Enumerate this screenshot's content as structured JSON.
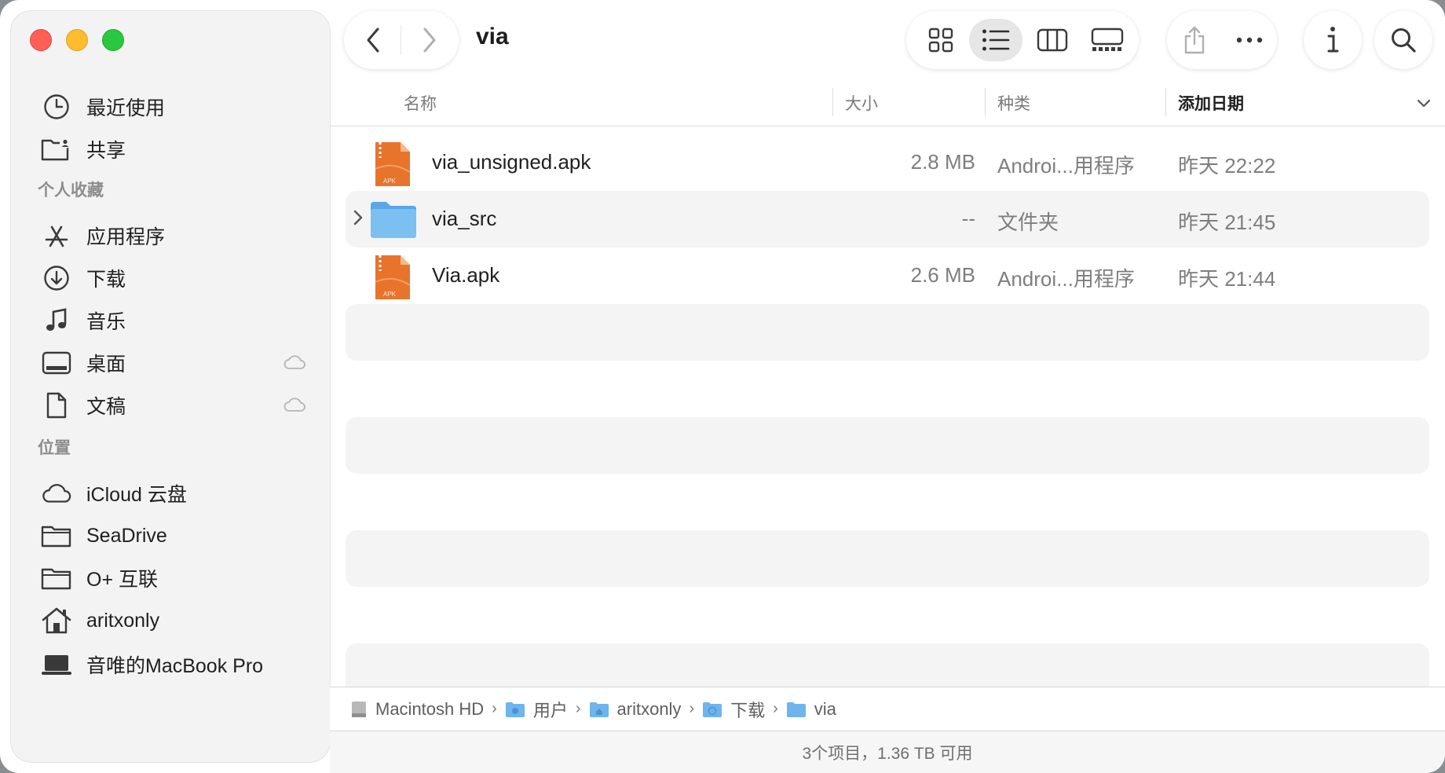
{
  "window": {
    "title": "via"
  },
  "sidebar": {
    "traffic_lights": [
      "close",
      "minimize",
      "zoom"
    ],
    "top_items": [
      {
        "label": "最近使用",
        "icon": "clock-icon"
      },
      {
        "label": "共享",
        "icon": "shared-folder-icon"
      }
    ],
    "favorites_header": "个人收藏",
    "favorites": [
      {
        "label": "应用程序",
        "icon": "applications-icon"
      },
      {
        "label": "下载",
        "icon": "download-icon"
      },
      {
        "label": "音乐",
        "icon": "music-note-icon"
      },
      {
        "label": "桌面",
        "icon": "desktop-icon",
        "cloud": true
      },
      {
        "label": "文稿",
        "icon": "document-icon",
        "cloud": true
      }
    ],
    "locations_header": "位置",
    "locations": [
      {
        "label": "iCloud 云盘",
        "icon": "cloud-icon"
      },
      {
        "label": "SeaDrive",
        "icon": "folder-icon"
      },
      {
        "label": "O+ 互联",
        "icon": "folder-icon"
      },
      {
        "label": "aritxonly",
        "icon": "home-icon"
      },
      {
        "label": "音唯的MacBook Pro",
        "icon": "laptop-icon"
      }
    ]
  },
  "toolbar": {
    "view_modes": [
      "icon-view",
      "list-view",
      "column-view",
      "gallery-view"
    ],
    "active_view": "list-view",
    "actions": [
      "share",
      "more",
      "info",
      "search"
    ]
  },
  "columns": {
    "name": "名称",
    "size": "大小",
    "kind": "种类",
    "date_added": "添加日期"
  },
  "files": [
    {
      "name": "via_unsigned.apk",
      "size": "2.8 MB",
      "kind": "Androi...用程序",
      "date": "昨天 22:22",
      "type": "apk"
    },
    {
      "name": "via_src",
      "size": "--",
      "kind": "文件夹",
      "date": "昨天 21:45",
      "type": "folder"
    },
    {
      "name": "Via.apk",
      "size": "2.6 MB",
      "kind": "Androi...用程序",
      "date": "昨天 21:44",
      "type": "apk"
    }
  ],
  "apk_badge": "APK",
  "path": [
    {
      "label": "Macintosh HD",
      "icon": "disk-icon"
    },
    {
      "label": "用户",
      "icon": "folder-icon"
    },
    {
      "label": "aritxonly",
      "icon": "home-folder-icon"
    },
    {
      "label": "下载",
      "icon": "download-folder-icon"
    },
    {
      "label": "via",
      "icon": "folder-icon"
    }
  ],
  "path_separator": "›",
  "status": "3个项目，1.36 TB 可用",
  "colors": {
    "accent_folder": "#6fb4ec",
    "apk_orange": "#e8742c",
    "stripe": "#f4f4f4"
  }
}
